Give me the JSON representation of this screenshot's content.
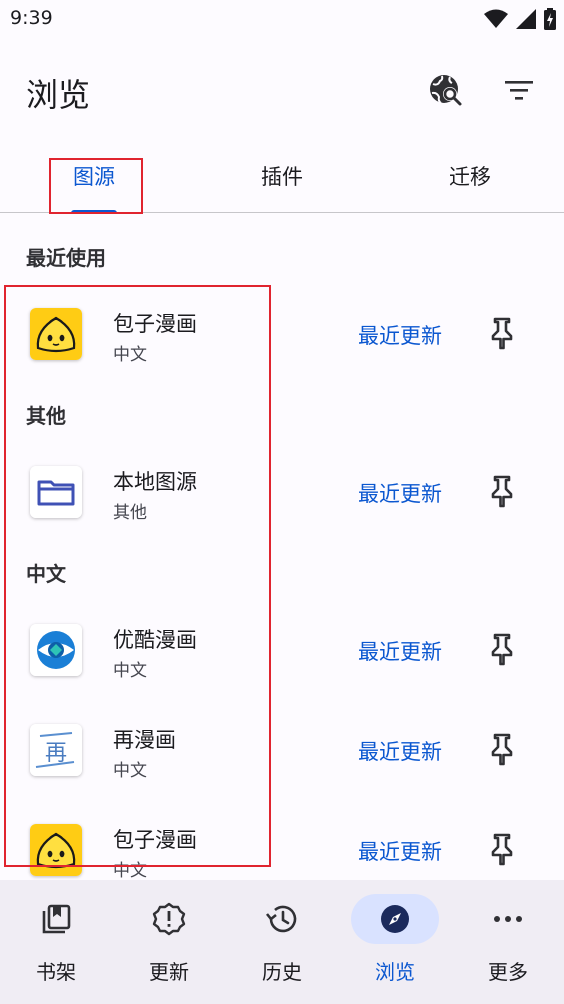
{
  "status_bar": {
    "time": "9:39"
  },
  "app_bar": {
    "title": "浏览",
    "icons": [
      "globe-search-icon",
      "filter-icon"
    ]
  },
  "tabs": [
    {
      "label": "图源",
      "active": true
    },
    {
      "label": "插件",
      "active": false
    },
    {
      "label": "迁移",
      "active": false
    }
  ],
  "sections": {
    "recent": "最近使用",
    "other": "其他",
    "chinese": "中文"
  },
  "sources": [
    {
      "name": "包子漫画",
      "lang": "中文",
      "latest": "最近更新",
      "icon": "baozi-icon"
    },
    {
      "name": "本地图源",
      "lang": "其他",
      "latest": "最近更新",
      "icon": "folder-icon"
    },
    {
      "name": "优酷漫画",
      "lang": "中文",
      "latest": "最近更新",
      "icon": "youku-icon"
    },
    {
      "name": "再漫画",
      "lang": "中文",
      "latest": "最近更新",
      "icon": "zai-manhua-icon"
    },
    {
      "name": "包子漫画",
      "lang": "中文",
      "latest": "最近更新",
      "icon": "baozi-icon"
    }
  ],
  "zai_logo_text": "再",
  "bottom_nav": [
    {
      "label": "书架",
      "icon": "bookshelf-icon",
      "active": false
    },
    {
      "label": "更新",
      "icon": "update-alert-icon",
      "active": false
    },
    {
      "label": "历史",
      "icon": "history-icon",
      "active": false
    },
    {
      "label": "浏览",
      "icon": "compass-icon",
      "active": true
    },
    {
      "label": "更多",
      "icon": "more-horizontal-icon",
      "active": false
    }
  ],
  "colors": {
    "accent": "#0b57d0",
    "background": "#fdfbff",
    "nav_background": "#f0edf4",
    "nav_active_pill": "#d9e2ff",
    "highlight_box": "#e0242f"
  }
}
